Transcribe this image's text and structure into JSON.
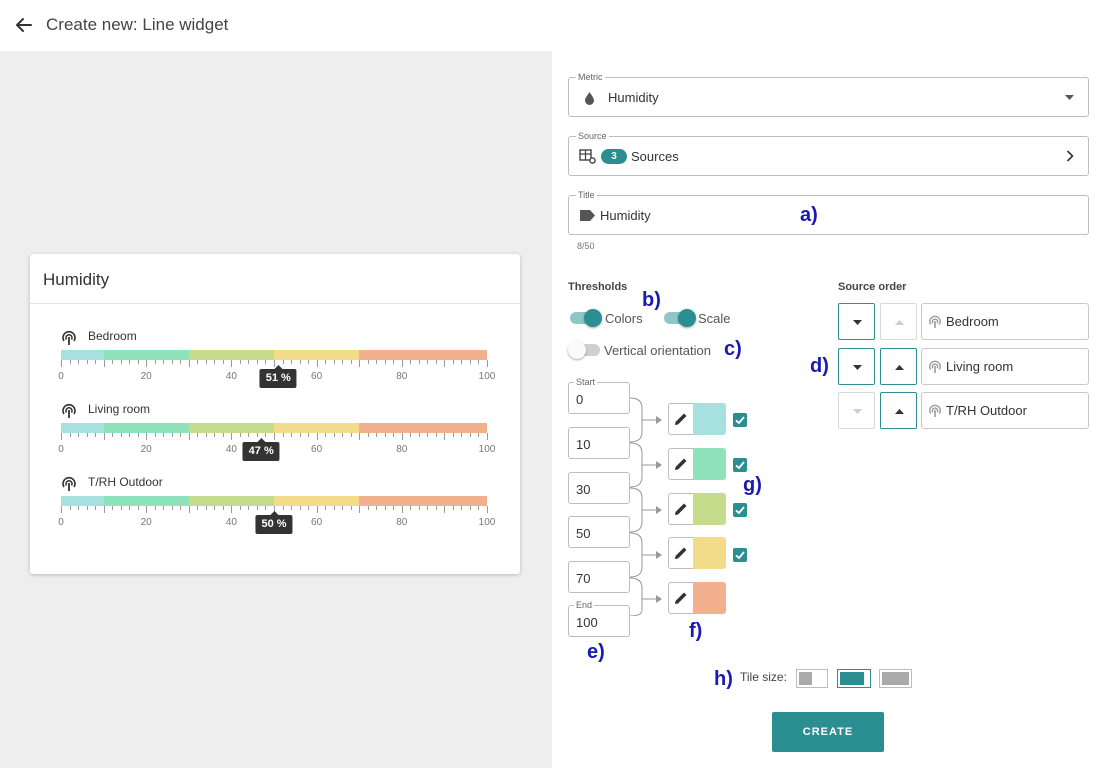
{
  "header": {
    "title": "Create new: Line widget"
  },
  "preview": {
    "card_title": "Humidity",
    "scale_labels": [
      "0",
      "20",
      "40",
      "60",
      "80",
      "100"
    ],
    "segment_colors": [
      "#a6e0df",
      "#8fe3ba",
      "#c5dc8c",
      "#f2dc8a",
      "#f2b08e"
    ],
    "segment_bounds": [
      0,
      10,
      30,
      50,
      70,
      100
    ],
    "sensors": [
      {
        "name": "Bedroom",
        "value": 51,
        "value_label": "51 %"
      },
      {
        "name": "Living room",
        "value": 47,
        "value_label": "47 %"
      },
      {
        "name": "T/RH Outdoor",
        "value": 50,
        "value_label": "50 %"
      }
    ]
  },
  "form": {
    "metric": {
      "label": "Metric",
      "value": "Humidity"
    },
    "source": {
      "label": "Source",
      "count": "3",
      "value": "Sources"
    },
    "title": {
      "label": "Title",
      "value": "Humidity",
      "counter": "8/50"
    },
    "thresholds": {
      "heading": "Thresholds",
      "colors_label": "Colors",
      "scale_label": "Scale",
      "vertical_label": "Vertical orientation",
      "colors_on": true,
      "scale_on": true,
      "vertical_on": false,
      "start_label": "Start",
      "end_label": "End",
      "values": [
        "0",
        "10",
        "30",
        "50",
        "70",
        "100"
      ],
      "colors": [
        "#a6e0df",
        "#8fe3ba",
        "#c5dc8c",
        "#f2dc8a",
        "#f2b08e"
      ],
      "checked": [
        true,
        true,
        true,
        true,
        false
      ]
    },
    "source_order": {
      "heading": "Source order",
      "items": [
        "Bedroom",
        "Living room",
        "T/RH Outdoor"
      ]
    },
    "tile_size": {
      "label": "Tile size:",
      "selected": 1
    },
    "create_label": "CREATE"
  },
  "annotations": [
    "a)",
    "b)",
    "c)",
    "d)",
    "e)",
    "f)",
    "g)",
    "h)"
  ],
  "colors": {
    "accent": "#2b8f91"
  }
}
